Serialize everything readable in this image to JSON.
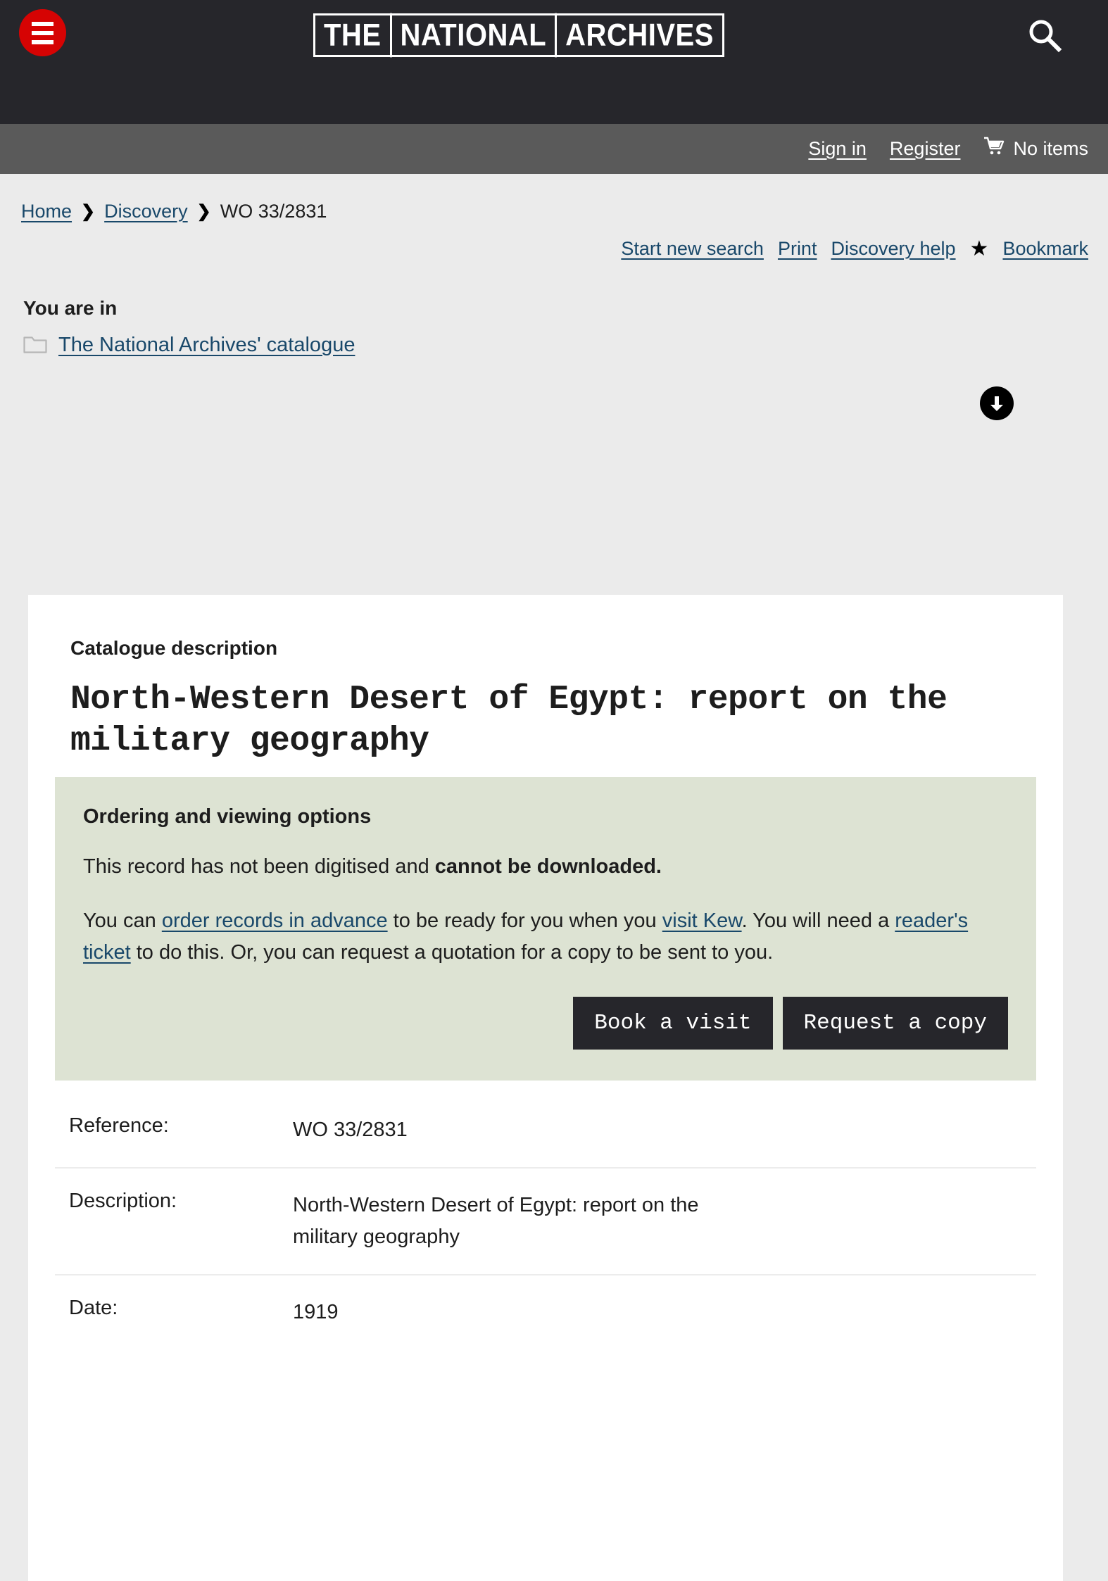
{
  "masthead": {
    "menu_icon": "hamburger-icon",
    "logo": [
      "THE",
      "NATIONAL",
      "ARCHIVES"
    ],
    "search_icon": "search-icon"
  },
  "utility": {
    "sign_in": "Sign in",
    "register": "Register",
    "cart_icon": "shopping-cart-icon",
    "cart_label": "No items"
  },
  "breadcrumb": {
    "home": "Home",
    "discovery": "Discovery",
    "current": "WO 33/2831",
    "separator": "❯"
  },
  "actions": {
    "start_new_search": "Start new search",
    "print": "Print",
    "discovery_help": "Discovery help",
    "bookmark_icon": "star-icon",
    "bookmark": "Bookmark"
  },
  "location": {
    "heading": "You are in",
    "folder_icon": "folder-icon",
    "catalogue_link": "The National Archives' catalogue"
  },
  "scroll": {
    "down_icon": "arrow-down-circle-icon"
  },
  "record": {
    "card_label": "Catalogue description",
    "title": "North-Western Desert of Egypt: report on the military geography"
  },
  "ordering": {
    "heading": "Ordering and viewing options",
    "digitised_prefix": "This record has not been digitised and ",
    "digitised_strong": "cannot be downloaded.",
    "para_1": "You can ",
    "link_order": "order records in advance",
    "para_2": " to be ready for you when you ",
    "link_kew": "visit Kew",
    "para_3": ". You will need a ",
    "link_ticket": "reader's ticket",
    "para_4": " to do this. Or, you can request a quotation for a copy to be sent to you.",
    "book_visit_button": "Book a visit",
    "request_copy_button": "Request a copy"
  },
  "details": [
    {
      "key": "Reference:",
      "value": "WO 33/2831"
    },
    {
      "key": "Description:",
      "value": "North-Western Desert of Egypt: report on the military geography"
    },
    {
      "key": "Date:",
      "value": "1919"
    }
  ],
  "colors": {
    "masthead_bg": "#26262b",
    "utility_bg": "#5a5a5a",
    "page_bg": "#ebebeb",
    "brand_red": "#d60303",
    "link_blue": "#19486a",
    "panel_green": "#dde3d3",
    "button_bg": "#26262b"
  }
}
